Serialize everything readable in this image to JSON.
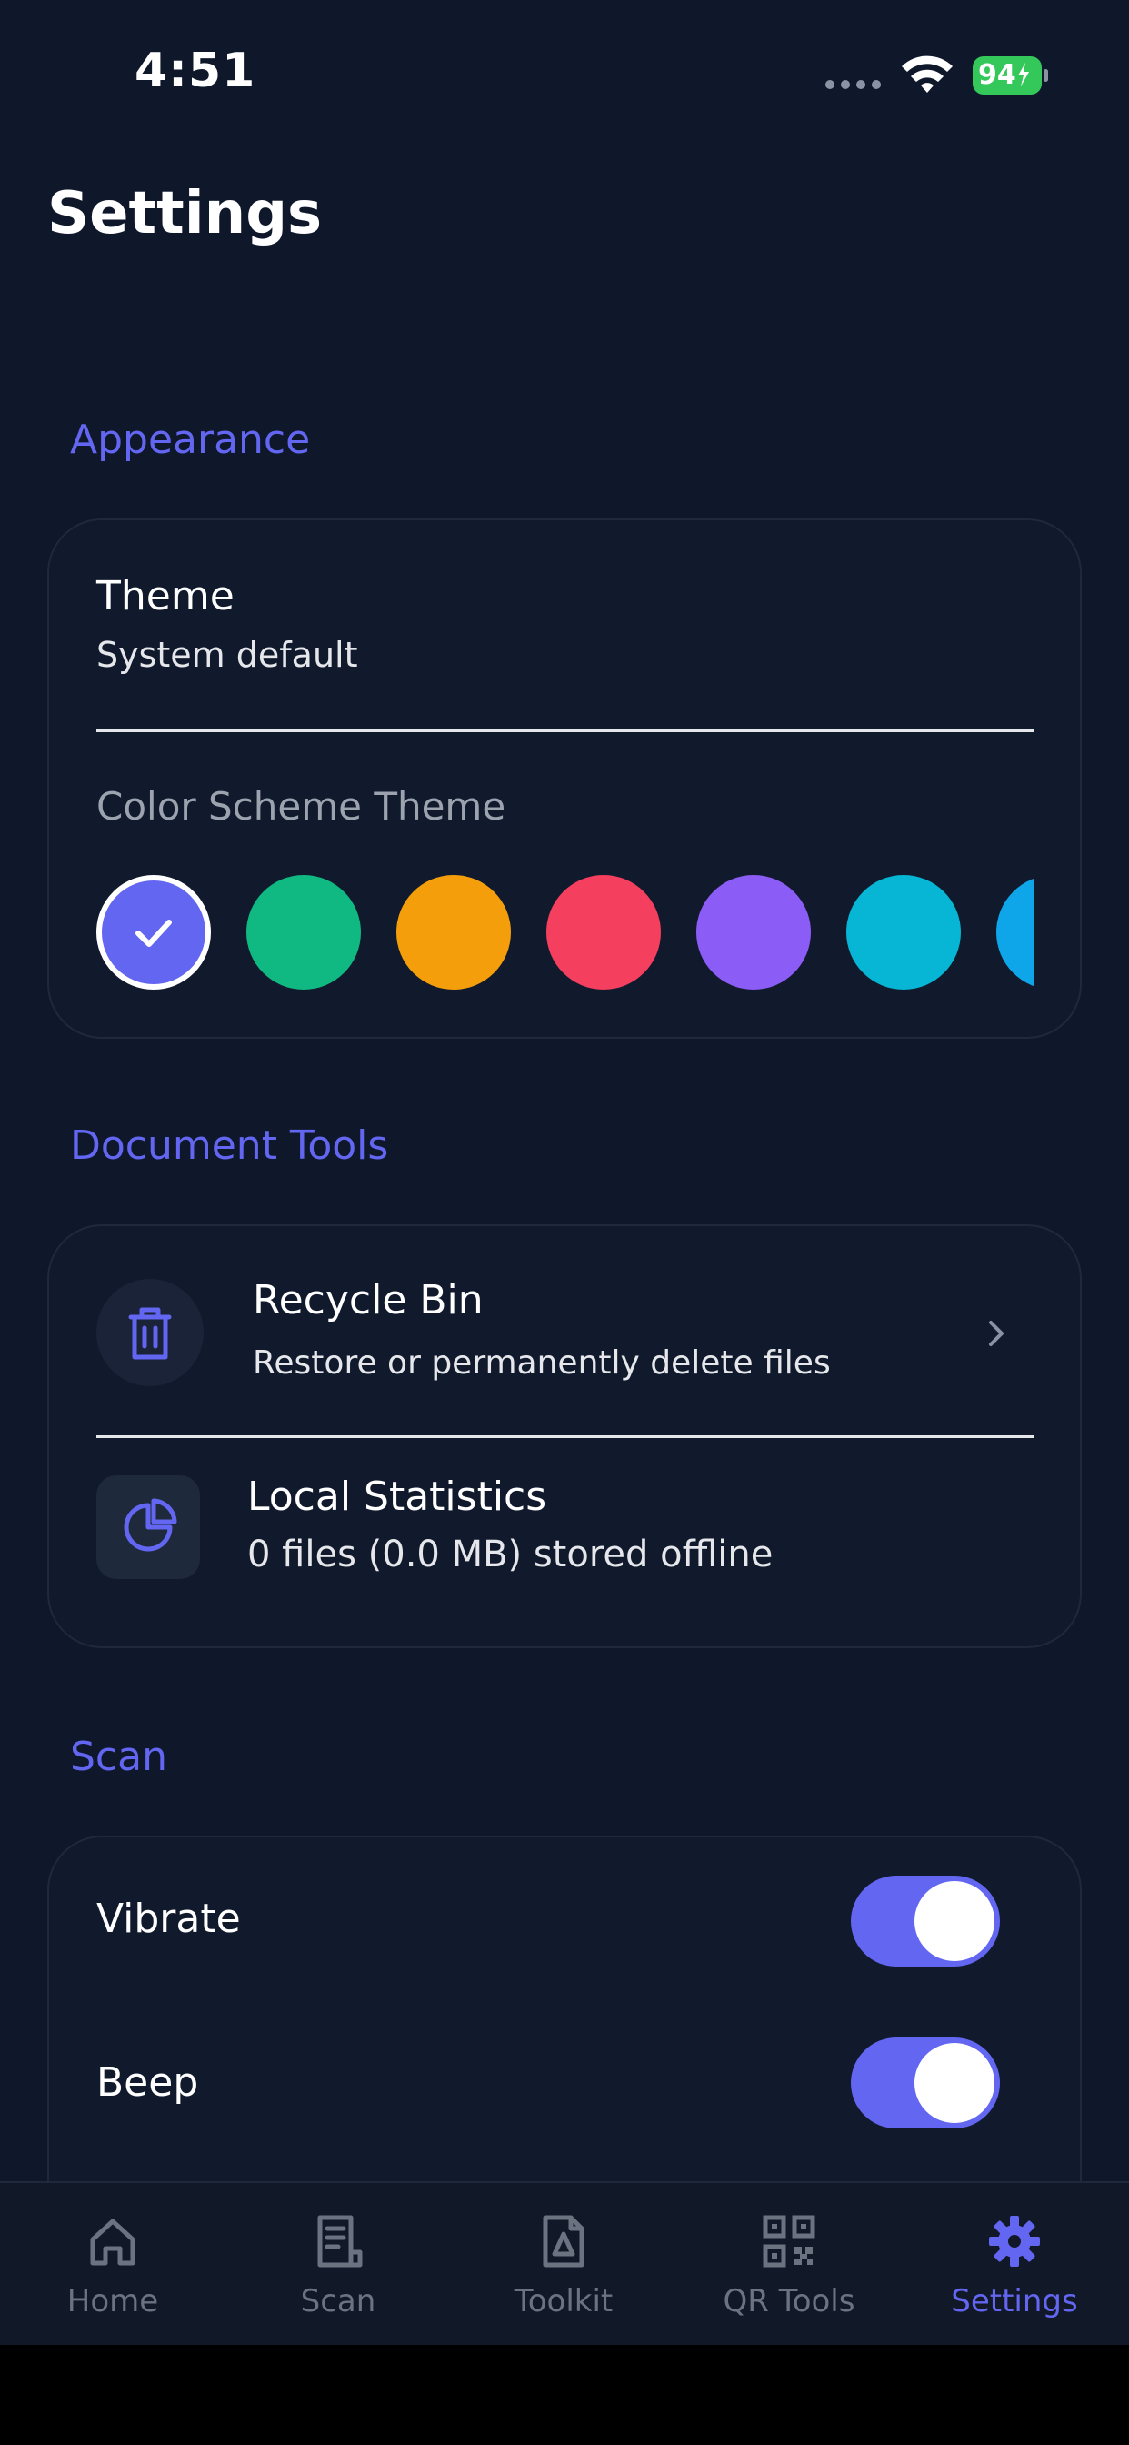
{
  "status_bar": {
    "time": "4:51",
    "battery": "94"
  },
  "page": {
    "title": "Settings"
  },
  "appearance": {
    "section_title": "Appearance",
    "theme_label": "Theme",
    "theme_value": "System default",
    "color_scheme_label": "Color Scheme Theme",
    "colors": [
      "#6366f1",
      "#10b981",
      "#f59e0b",
      "#f43f5e",
      "#8b5cf6",
      "#06b6d4",
      "#0ea5e9"
    ],
    "selected_color_index": 0
  },
  "document_tools": {
    "section_title": "Document Tools",
    "recycle_bin": {
      "title": "Recycle Bin",
      "subtitle": "Restore or permanently delete files"
    },
    "local_statistics": {
      "title": "Local Statistics",
      "subtitle": "0 files (0.0 MB) stored offline"
    }
  },
  "scan": {
    "section_title": "Scan",
    "vibrate": {
      "label": "Vibrate",
      "on": true
    },
    "beep": {
      "label": "Beep",
      "on": true
    }
  },
  "bottom_nav": {
    "items": [
      {
        "label": "Home",
        "icon": "home-icon"
      },
      {
        "label": "Scan",
        "icon": "document-icon"
      },
      {
        "label": "Toolkit",
        "icon": "pdf-icon"
      },
      {
        "label": "QR Tools",
        "icon": "qr-code-icon"
      },
      {
        "label": "Settings",
        "icon": "gear-icon"
      }
    ],
    "active_index": 4
  },
  "colors": {
    "accent": "#6366f1",
    "background": "#0f172a",
    "card": "#111a2d"
  }
}
